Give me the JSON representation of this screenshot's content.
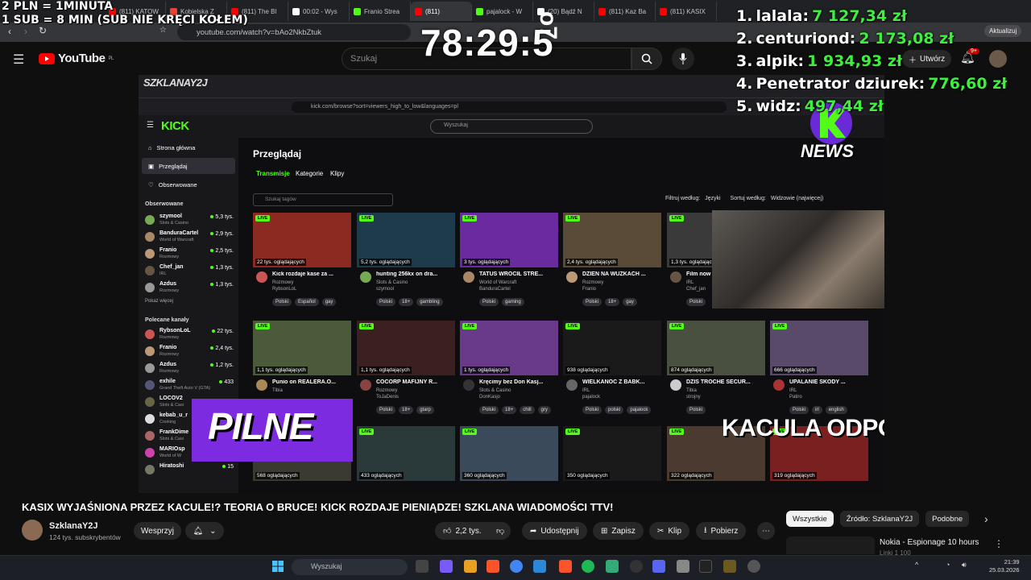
{
  "browser": {
    "tabs": [
      {
        "label": "(811) KATOW",
        "color": "#ff0000",
        "active": false
      },
      {
        "label": "Kobielska Z",
        "color": "#ea4335",
        "active": false
      },
      {
        "label": "(811) The Bl",
        "color": "#ff0000",
        "active": false
      },
      {
        "label": "00:02 - Wys",
        "color": "#ffffff",
        "active": false
      },
      {
        "label": "Franio Strea",
        "color": "#53fc18",
        "active": false
      },
      {
        "label": "(811)",
        "color": "#ff0000",
        "active": true
      },
      {
        "label": "pajalock - W",
        "color": "#53fc18",
        "active": false
      },
      {
        "label": "(20) Bądź N",
        "color": "#ffffff",
        "active": false
      },
      {
        "label": "(811) Kaz Ba",
        "color": "#ff0000",
        "active": false
      },
      {
        "label": "(811) KASIX",
        "color": "#ff0000",
        "active": false
      }
    ],
    "url": "youtube.com/watch?v=bAo2NkbZtuk",
    "update_label": "Aktualizuj"
  },
  "overlay": {
    "donate_line1": "2 PLN =  1MINUTA",
    "donate_line2": "1 SUB = 8 MIN (SUB NIE KRĘCI KOŁEM)",
    "timer": "78:29:5",
    "timer_extra": "o7",
    "leaderboard": [
      {
        "rank": "1.",
        "name": "lalala:",
        "amount": "7 127,34 zł"
      },
      {
        "rank": "2.",
        "name": "centuriond:",
        "amount": "2 173,08 zł"
      },
      {
        "rank": "3.",
        "name": "alpik:",
        "amount": "1 934,93 zł"
      },
      {
        "rank": "4.",
        "name": "Penetrator dziurek:",
        "amount": "776,60 zł"
      },
      {
        "rank": "5.",
        "name": "widz:",
        "amount": "497,44 zł"
      }
    ],
    "news_badge": "NEWS",
    "pilne": "PILNE",
    "kacula": "KACULA ODPO"
  },
  "youtube": {
    "logo": "YouTube",
    "logo_region": "PL",
    "search_placeholder": "Szukaj",
    "create_label": "Utwórz",
    "notif_count": "9+",
    "video_title": "KASIX WYJAŚNIONA PRZEZ KACULE!? TEORIA O BRUCE! KICK ROZDAJE PIENIĄDZE! SZKLANA WIADOMOŚCI TTV!",
    "channel": "SzklanaY2J",
    "subscribers": "124 tys. subskrybentów",
    "support_label": "Wesprzyj",
    "likes": "2,2 tys.",
    "share_label": "Udostępnij",
    "save_label": "Zapisz",
    "clip_label": "Klip",
    "download_label": "Pobierz",
    "chips": [
      "Wszystkie",
      "Źródło: SzklanaY2J",
      "Podobne"
    ],
    "rec_title": "Nokia - Espionage 10 hours",
    "rec_sub": "Linki 1 100"
  },
  "kick": {
    "watermark": "SZKLANAY2J",
    "url": "kick.com/browse?sort=viewers_high_to_low&languages=pl",
    "logo": "KICK",
    "search_placeholder": "Wyszukaj",
    "nav": [
      "Strona główna",
      "Przeglądaj",
      "Obserwowane"
    ],
    "followed_header": "Obserwowane",
    "followed": [
      {
        "name": "szymool",
        "cat": "Slots & Casino",
        "viewers": "5,3 tys.",
        "color": "#7a5"
      },
      {
        "name": "BanduraCartel",
        "cat": "World of Warcraft",
        "viewers": "2,9 tys.",
        "color": "#a86"
      },
      {
        "name": "Franio",
        "cat": "Rozmowy",
        "viewers": "2,5 tys.",
        "color": "#b97"
      },
      {
        "name": "Chef_jan",
        "cat": "IRL",
        "viewers": "1,3 tys.",
        "color": "#654"
      },
      {
        "name": "Azdus",
        "cat": "Rozmowy",
        "viewers": "1,3 tys.",
        "color": "#999"
      }
    ],
    "show_more": "Pokaż więcej",
    "recommended_header": "Polecane kanały",
    "recommended": [
      {
        "name": "RybsonLoL",
        "cat": "Rozmowy",
        "viewers": "22 tys.",
        "color": "#c55"
      },
      {
        "name": "Franio",
        "cat": "Rozmowy",
        "viewers": "2,4 tys.",
        "color": "#b97"
      },
      {
        "name": "Azdus",
        "cat": "Rozmowy",
        "viewers": "1,2 tys.",
        "color": "#999"
      },
      {
        "name": "exhile",
        "cat": "Grand Theft Auto V (GTA)",
        "viewers": "433",
        "color": "#557"
      },
      {
        "name": "LOCOV2",
        "cat": "Slots & Casi",
        "viewers": "",
        "color": "#664"
      },
      {
        "name": "kebab_u_r",
        "cat": "Cooking",
        "viewers": "",
        "color": "#ddd"
      },
      {
        "name": "FrankDime",
        "cat": "Slots & Casi",
        "viewers": "",
        "color": "#a66"
      },
      {
        "name": "MARIOsp",
        "cat": "World of W",
        "viewers": "",
        "color": "#c4a"
      },
      {
        "name": "Hiratoshi",
        "cat": "",
        "viewers": "15",
        "color": "#776"
      }
    ],
    "page_title": "Przeglądaj",
    "tabs": [
      "Transmisje",
      "Kategorie",
      "Klipy"
    ],
    "tag_search": "Szukaj tagów",
    "filter_label": "Filtruj według:",
    "lang_label": "Języki",
    "sort_label": "Sortuj według:",
    "sort_value": "Widzowie (najwięcej)",
    "live_label": "LIVE",
    "streams_row1": [
      {
        "viewers": "22 tys. oglądających",
        "title": "Kick rozdaje kase za ...",
        "cat": "Rozmowy",
        "name": "RybsonLoL",
        "tags": [
          "Polski",
          "Español",
          "gay"
        ],
        "bg": "#8a2a20",
        "av": "#c55"
      },
      {
        "viewers": "5,2 tys. oglądających",
        "title": "hunting 256kx on dra...",
        "cat": "Slots & Casino",
        "name": "szymool",
        "tags": [
          "Polski",
          "18+",
          "gambling"
        ],
        "bg": "#1d3b4a",
        "av": "#7a5"
      },
      {
        "viewers": "3 tys. oglądających",
        "title": "TATUŚ WRÓCIŁ STRE...",
        "cat": "World of Warcraft",
        "name": "BanduraCartel",
        "tags": [
          "Polski",
          "gaming"
        ],
        "bg": "#6a2aa0",
        "av": "#a86"
      },
      {
        "viewers": "2,4 tys. oglądających",
        "title": "DZIEŃ NA WUZKACH ...",
        "cat": "Rozmowy",
        "name": "Franio",
        "tags": [
          "Polski",
          "18+",
          "gay"
        ],
        "bg": "#5a4a38",
        "av": "#b97"
      },
      {
        "viewers": "1,3 tys. oglądających",
        "title": "Film now",
        "cat": "IRL",
        "name": "Chef_jan",
        "tags": [
          "Polski"
        ],
        "bg": "#3a3a3a",
        "av": "#654"
      }
    ],
    "streams_row2": [
      {
        "viewers": "1,1 tys. oglądających",
        "title": "Punio on REALERA.O...",
        "cat": "Tibia",
        "name": "",
        "tags": [
          "Polski"
        ],
        "bg": "#4a5a3a",
        "av": "#a85"
      },
      {
        "viewers": "1,1 tys. oglądających",
        "title": "COCORP MAFIJNY R...",
        "cat": "Rozmowy",
        "name": "ToJaDenis",
        "tags": [
          "Polski",
          "18+",
          "gtarp"
        ],
        "bg": "#3a2020",
        "av": "#844"
      },
      {
        "viewers": "1 tys. oglądających",
        "title": "Kręcimy bez Don Kasj...",
        "cat": "Slots & Casino",
        "name": "DonKasjo",
        "tags": [
          "Polski",
          "18+",
          "chill",
          "gry"
        ],
        "bg": "#6a3a8a",
        "av": "#333"
      },
      {
        "viewers": "938 oglądających",
        "title": "WIELKANOC Z BABK...",
        "cat": "IRL",
        "name": "pajalock",
        "tags": [
          "Polski",
          "polski",
          "pajalock"
        ],
        "bg": "#1a1a1a",
        "av": "#666"
      },
      {
        "viewers": "874 oglądających",
        "title": "DZIŚ TROCHE SECUR...",
        "cat": "Tibia",
        "name": "strojny",
        "tags": [
          "Polski"
        ],
        "bg": "#4a5040",
        "av": "#ccc"
      },
      {
        "viewers": "666 oglądających",
        "title": "UPALANIE SKODY ...",
        "cat": "IRL",
        "name": "Patiro",
        "tags": [
          "Polski",
          "irl",
          "english"
        ],
        "bg": "#5a4a6a",
        "av": "#a33"
      }
    ],
    "streams_row3": [
      {
        "viewers": "568 oglądających",
        "bg": "#3a3a30"
      },
      {
        "viewers": "433 oglądających",
        "bg": "#2a3a3a"
      },
      {
        "viewers": "360 oglądających",
        "bg": "#3a4a5a"
      },
      {
        "viewers": "350 oglądających",
        "bg": "#1a1a1a"
      },
      {
        "viewers": "322 oglądających",
        "bg": "#4a3a30"
      },
      {
        "viewers": "319 oglądających",
        "bg": "#7a2020"
      }
    ]
  },
  "taskbar": {
    "search_placeholder": "Wyszukaj",
    "time": "21:39",
    "date": "25.03.2026"
  }
}
